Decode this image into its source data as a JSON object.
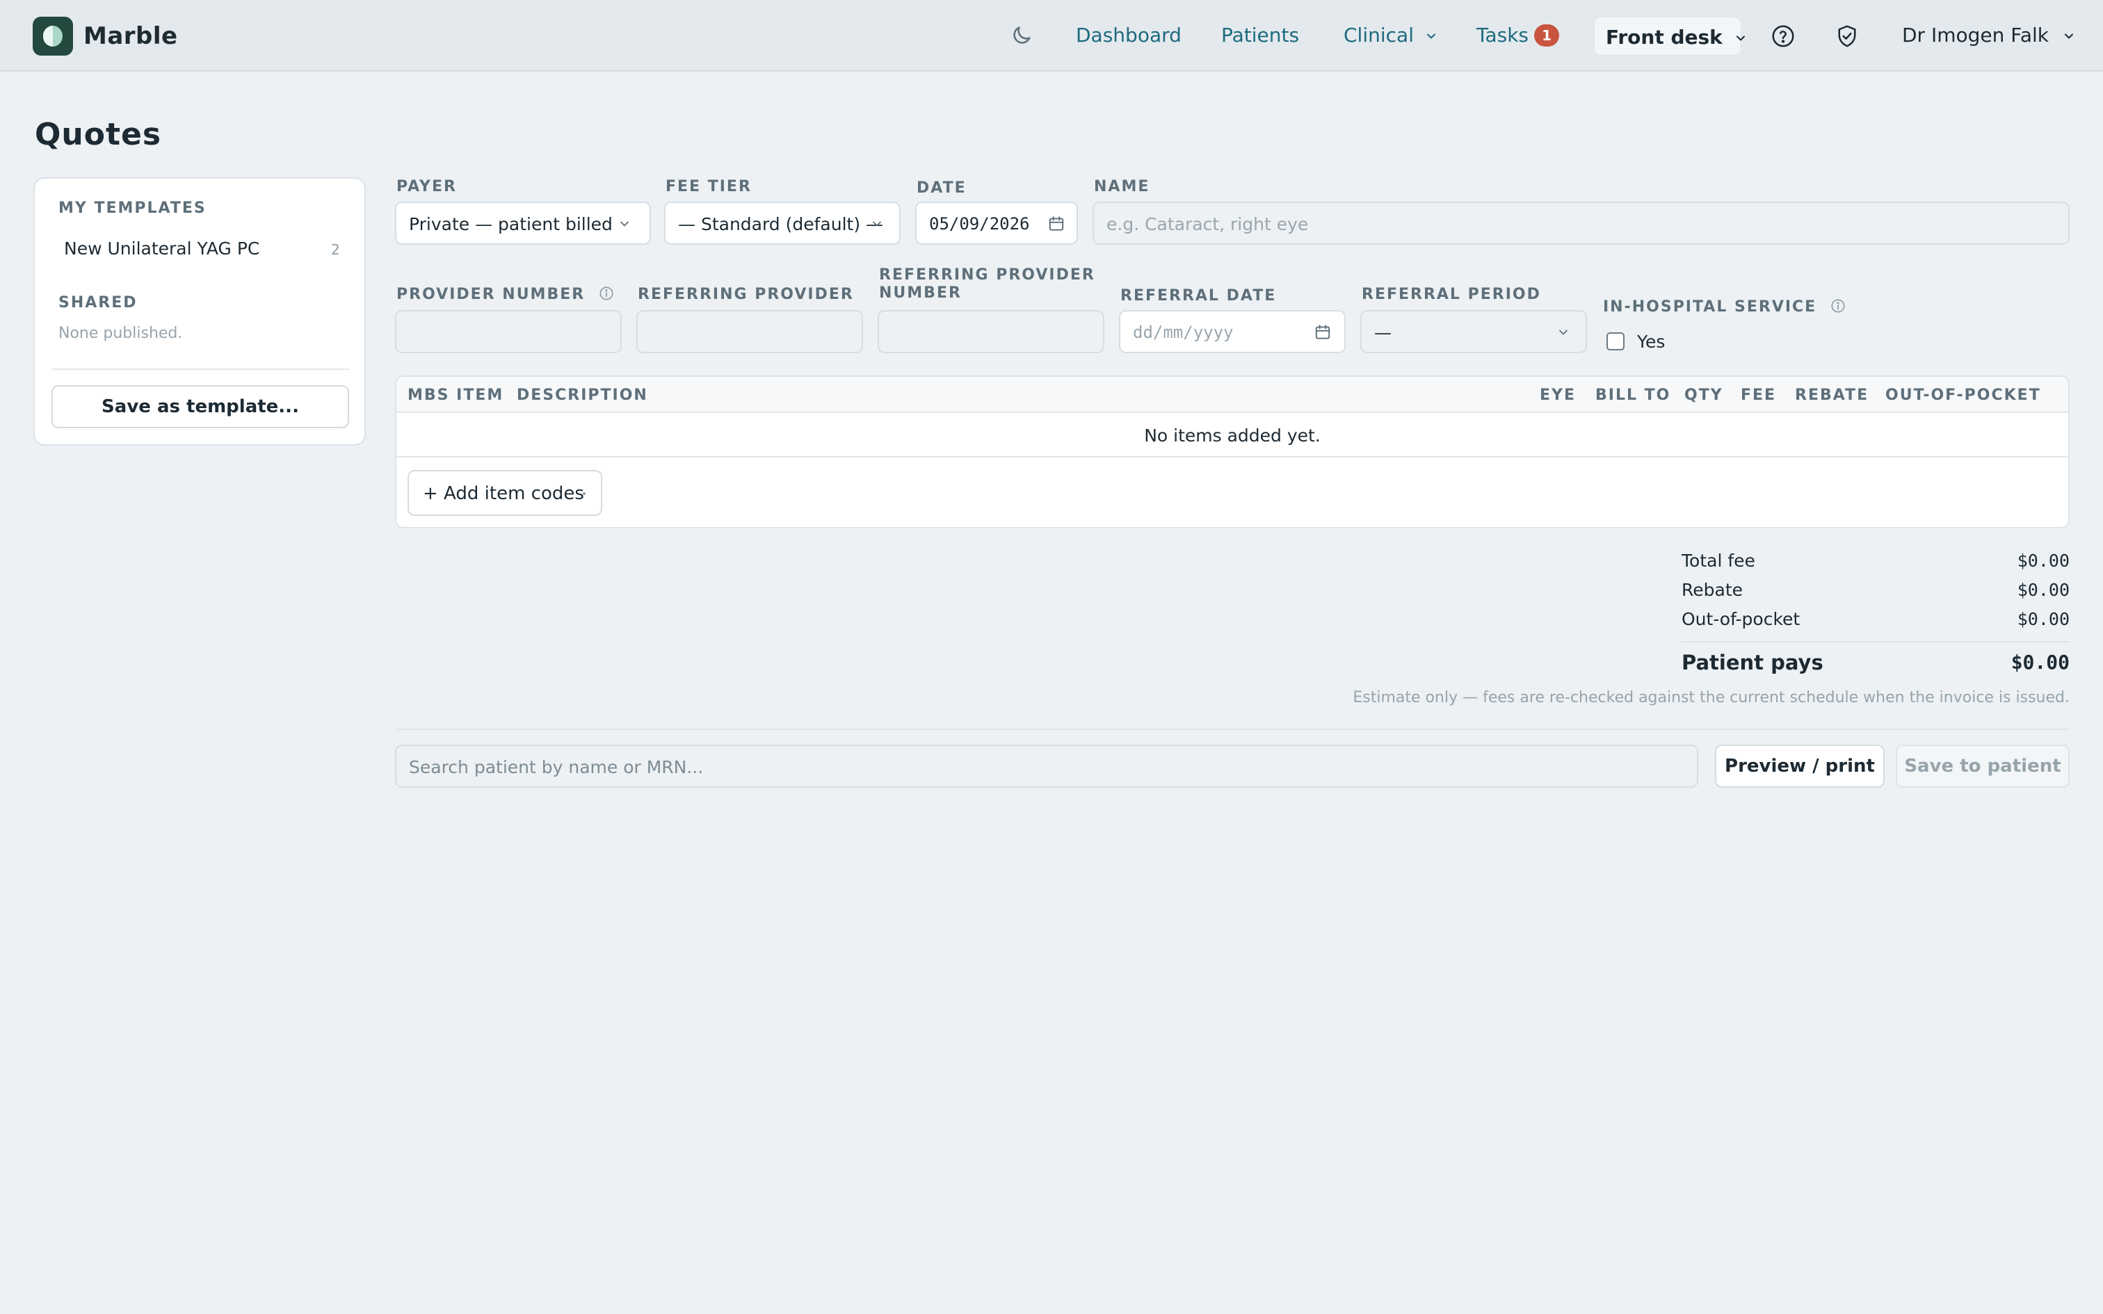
{
  "app": {
    "brand": "Marble"
  },
  "nav": {
    "dashboard": "Dashboard",
    "patients": "Patients",
    "clinical": "Clinical",
    "tasks": "Tasks",
    "tasks_count": "1",
    "front_desk": "Front desk",
    "user": "Dr Imogen Falk"
  },
  "page": {
    "title": "Quotes"
  },
  "sidebar": {
    "my_templates_heading": "MY TEMPLATES",
    "templates": [
      {
        "label": "New Unilateral YAG PC",
        "count": "2"
      }
    ],
    "shared_heading": "SHARED",
    "shared_empty": "None published.",
    "save_template_label": "Save as template..."
  },
  "form": {
    "payer": {
      "label": "PAYER",
      "value": "Private — patient billed"
    },
    "fee_tier": {
      "label": "FEE TIER",
      "value": "— Standard (default) —"
    },
    "date": {
      "label": "DATE",
      "value": "05/09/2026"
    },
    "name": {
      "label": "NAME",
      "placeholder": "e.g. Cataract, right eye"
    },
    "provider_number": {
      "label": "PROVIDER NUMBER",
      "value": ""
    },
    "referring_provider": {
      "label": "REFERRING PROVIDER",
      "value": ""
    },
    "referring_provider_number": {
      "label_line1": "REFERRING PROVIDER",
      "label_line2": "NUMBER",
      "value": ""
    },
    "referral_date": {
      "label": "REFERRAL DATE",
      "placeholder": "dd/mm/yyyy"
    },
    "referral_period": {
      "label": "REFERRAL PERIOD",
      "value": "—"
    },
    "in_hospital": {
      "label": "IN-HOSPITAL SERVICE",
      "option": "Yes",
      "checked": false
    }
  },
  "items_table": {
    "columns": [
      "MBS ITEM",
      "DESCRIPTION",
      "EYE",
      "BILL TO",
      "QTY",
      "FEE",
      "REBATE",
      "OUT-OF-POCKET"
    ],
    "rows": [],
    "empty_message": "No items added yet.",
    "add_label": "+ Add item codes"
  },
  "totals": {
    "total_fee_label": "Total fee",
    "total_fee": "$0.00",
    "rebate_label": "Rebate",
    "rebate": "$0.00",
    "oop_label": "Out-of-pocket",
    "oop": "$0.00",
    "patient_pays_label": "Patient pays",
    "patient_pays": "$0.00",
    "note": "Estimate only — fees are re-checked against the current schedule when the invoice is issued."
  },
  "footer": {
    "search_placeholder": "Search patient by name or MRN...",
    "preview_label": "Preview / print",
    "save_label": "Save to patient"
  },
  "colors": {
    "accent": "#1d6b7e",
    "badge": "#c9553e",
    "logo_bg": "#23493f",
    "background": "#edf1f4"
  }
}
